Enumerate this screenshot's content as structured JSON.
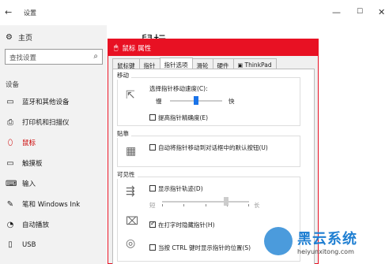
{
  "window": {
    "title": "设置",
    "back_icon": "←",
    "controls": [
      "—",
      "☐",
      "✕"
    ]
  },
  "sidebar": {
    "home_label": "主页",
    "search_placeholder": "查找设置",
    "section_label": "设备",
    "items": [
      {
        "label": "蓝牙和其他设备",
        "icon": "▭"
      },
      {
        "label": "打印机和扫描仪",
        "icon": "⎙"
      },
      {
        "label": "鼠标",
        "icon": "⬯"
      },
      {
        "label": "触摸板",
        "icon": "▭"
      },
      {
        "label": "输入",
        "icon": "⌨"
      },
      {
        "label": "笔和 Windows Ink",
        "icon": "✎"
      },
      {
        "label": "自动播放",
        "icon": "◔"
      },
      {
        "label": "USB",
        "icon": "▯"
      }
    ],
    "active_index": 2
  },
  "main": {
    "heading": "鼠标"
  },
  "dialog": {
    "title": "鼠标 属性",
    "tabs": [
      "鼠标键",
      "指针",
      "指针选项",
      "滑轮",
      "硬件",
      "ThinkPad"
    ],
    "active_tab": 2,
    "motion": {
      "group_label": "移动",
      "speed_label": "选择指针移动速度(C):",
      "slow_label": "慢",
      "fast_label": "快",
      "speed_value": 0.5,
      "precision_label": "提高指针精确度(E)",
      "precision_checked": false
    },
    "snap": {
      "group_label": "贴靠",
      "snap_label": "自动将指针移动到对话框中的默认按钮(U)",
      "snap_checked": false
    },
    "visibility": {
      "group_label": "可见性",
      "trails_label": "显示指针轨迹(D)",
      "trails_checked": false,
      "short_label": "短",
      "long_label": "长",
      "trails_value": 0.75,
      "hide_label": "在打字时隐藏指针(H)",
      "hide_checked": true,
      "ctrl_label": "当按 CTRL 键时显示指针的位置(S)",
      "ctrl_checked": false
    }
  },
  "watermark": {
    "brand": "黑云系统",
    "url": "heiyunxitong.com"
  },
  "colors": {
    "dialog_accent": "#e81123",
    "slider_thumb": "#1a73e8",
    "watermark": "#1f7fd2"
  }
}
